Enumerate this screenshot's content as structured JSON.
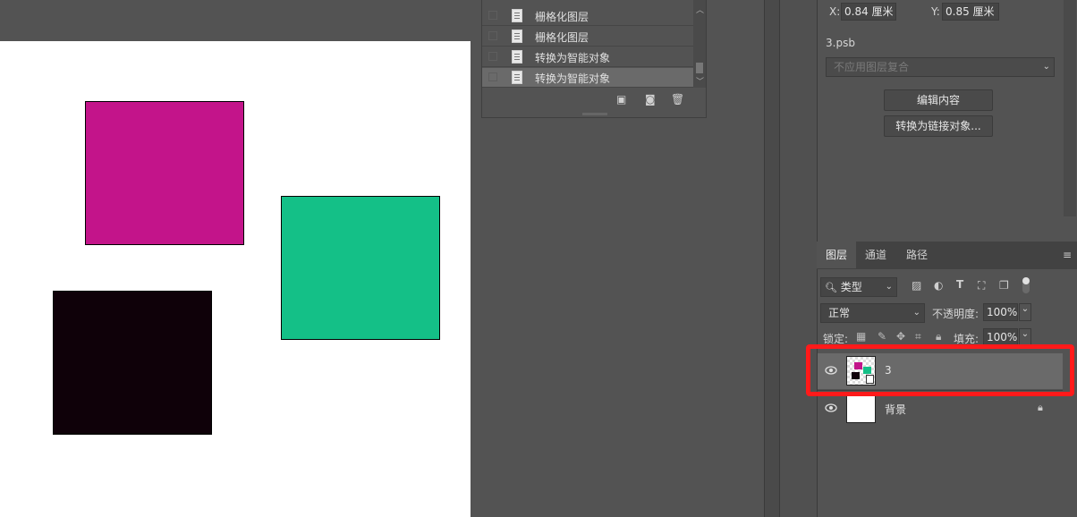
{
  "canvas": {
    "shapes": [
      {
        "name": "magenta-square",
        "color": "#c3148a"
      },
      {
        "name": "green-square",
        "color": "#14c087"
      },
      {
        "name": "black-square",
        "color": "#0f0109"
      }
    ]
  },
  "history": {
    "items": [
      {
        "label": "栅格化图层",
        "selected": false
      },
      {
        "label": "栅格化图层",
        "selected": false
      },
      {
        "label": "转换为智能对象",
        "selected": false
      },
      {
        "label": "转换为智能对象",
        "selected": true
      }
    ],
    "footer_icons": [
      "new-snapshot-icon",
      "camera-icon",
      "trash-icon"
    ]
  },
  "properties": {
    "x_label": "X:",
    "x_value": "0.84 厘米",
    "y_label": "Y:",
    "y_value": "0.85 厘米",
    "file_name": "3.psb",
    "comp_select": "不应用图层复合",
    "edit_button": "编辑内容",
    "convert_button": "转换为链接对象..."
  },
  "layers": {
    "tabs": [
      "图层",
      "通道",
      "路径"
    ],
    "active_tab": "图层",
    "filter_select": "类型",
    "blend_mode": "正常",
    "opacity_label": "不透明度:",
    "opacity_value": "100%",
    "lock_label": "锁定:",
    "fill_label": "填充:",
    "fill_value": "100%",
    "rows": [
      {
        "name": "3",
        "selected": true
      },
      {
        "name": "背景",
        "selected": false,
        "locked": true
      }
    ]
  },
  "colors": {
    "highlight": "#ff1a1a",
    "panel_bg": "#535353"
  }
}
